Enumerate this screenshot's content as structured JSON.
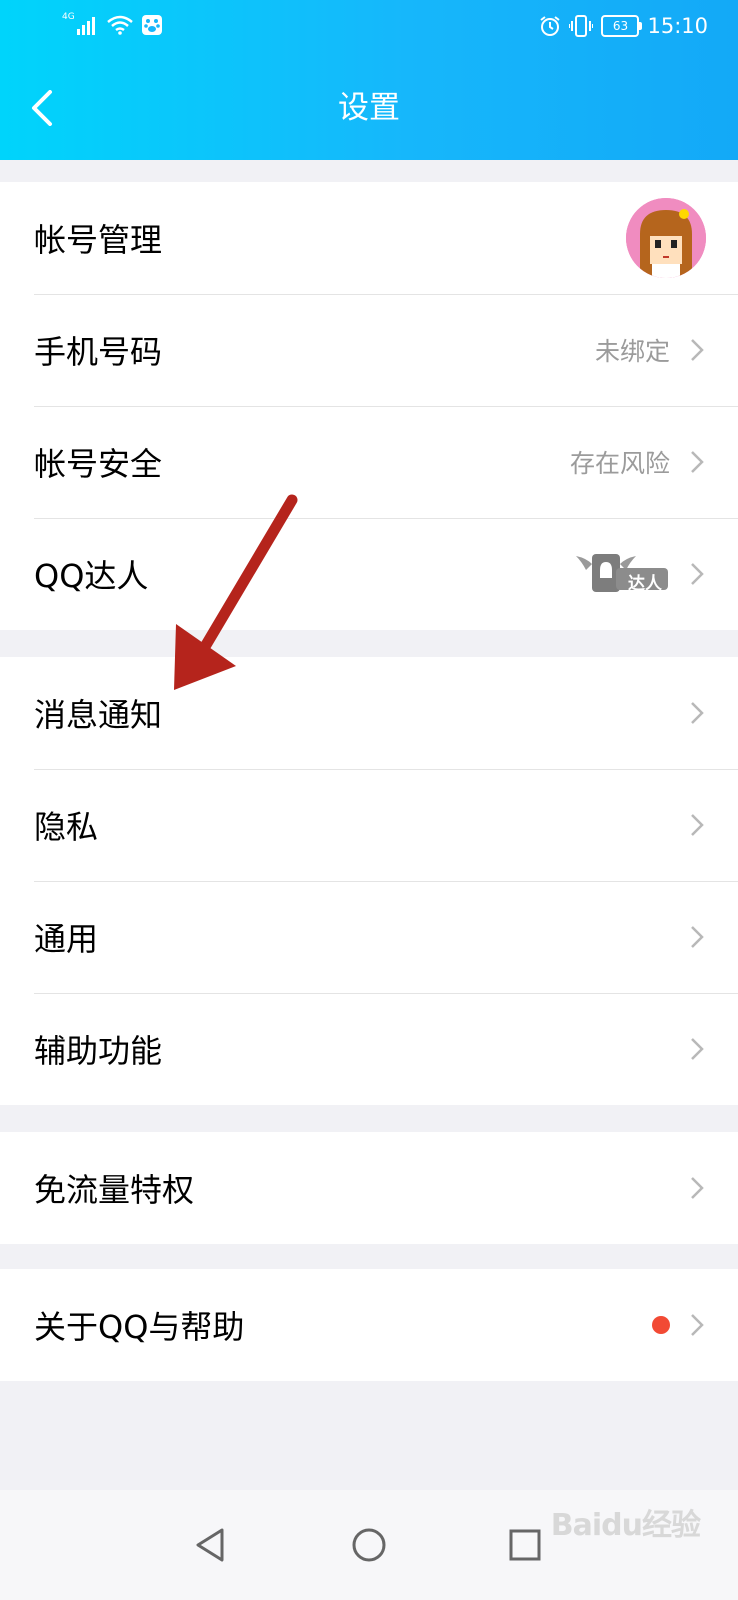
{
  "status_bar": {
    "network": "4G",
    "battery": "63",
    "time": "15:10"
  },
  "header": {
    "title": "设置",
    "back_icon": "back-chevron-icon"
  },
  "groups": [
    {
      "items": [
        {
          "label": "帐号管理",
          "value": "",
          "trailing": "avatar"
        },
        {
          "label": "手机号码",
          "value": "未绑定",
          "trailing": "chevron"
        },
        {
          "label": "帐号安全",
          "value": "存在风险",
          "trailing": "chevron"
        },
        {
          "label": "QQ达人",
          "value": "",
          "badge_text": "达人",
          "trailing": "chevron"
        }
      ]
    },
    {
      "items": [
        {
          "label": "消息通知",
          "trailing": "chevron"
        },
        {
          "label": "隐私",
          "trailing": "chevron"
        },
        {
          "label": "通用",
          "trailing": "chevron"
        },
        {
          "label": "辅助功能",
          "trailing": "chevron"
        }
      ]
    },
    {
      "items": [
        {
          "label": "免流量特权",
          "trailing": "chevron"
        }
      ]
    },
    {
      "items": [
        {
          "label": "关于QQ与帮助",
          "trailing": "chevron",
          "dot_color": "#f24a34"
        }
      ]
    }
  ],
  "nav_bar": {
    "buttons": [
      "back-triangle-icon",
      "home-circle-icon",
      "recents-square-icon"
    ]
  },
  "watermark": "Baidu经验",
  "colors": {
    "header_start": "#00d4fb",
    "header_end": "#13a9f7",
    "annotation_arrow": "#b5241c"
  }
}
